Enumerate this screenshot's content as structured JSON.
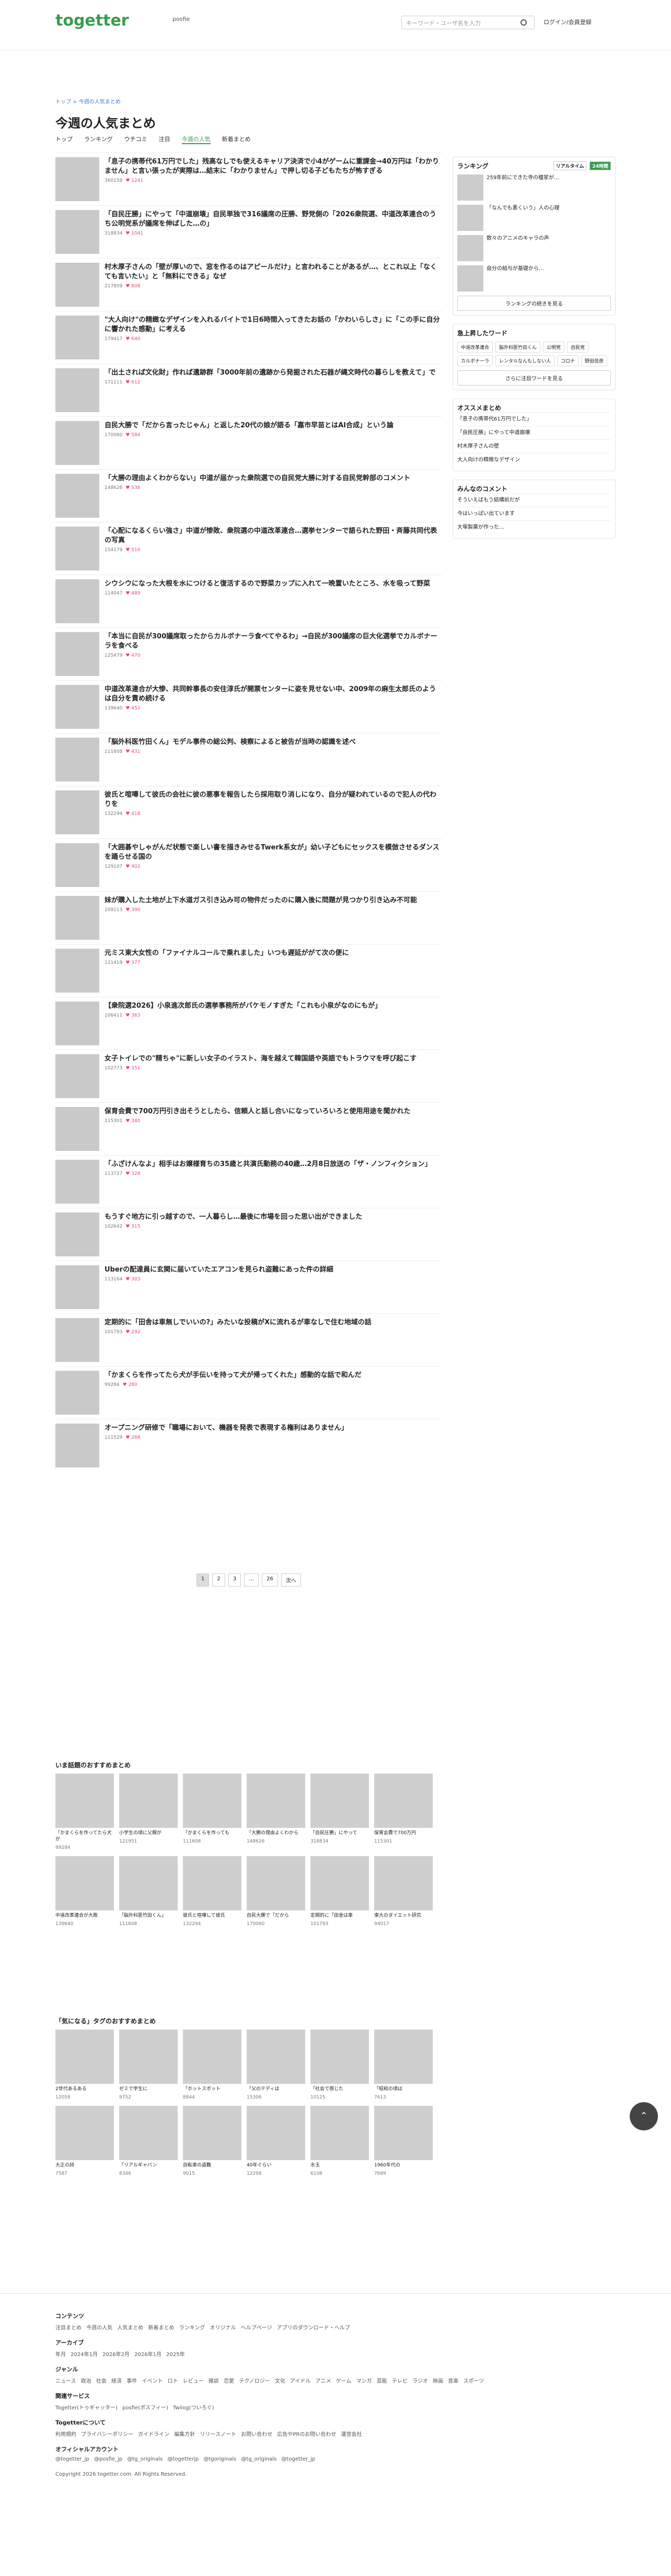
{
  "header": {
    "logo": "togetter",
    "logo_sub": "posfie",
    "search_placeholder": "キーワード・ユーザ名を入力",
    "login": "ログイン/会員登録"
  },
  "breadcrumb": "トップ > 今週の人気まとめ",
  "page_title": "今週の人気まとめ",
  "tabs": [
    "トップ",
    "ランキング",
    "ウチコミ",
    "注目",
    "今週の人気",
    "新着まとめ"
  ],
  "items": [
    {
      "t": "「息子の携帯代61万円でした」残高なしでも使えるキャリア決済で小4がゲームに重課金→40万円は「わかりません」と言い張ったが実際は…結末に「わかりません」で押し切る子どもたちが怖すぎる",
      "v": "360158",
      "f": "1241"
    },
    {
      "t": "「自民圧勝」にやって「中道崩壊」自民単独で316議席の圧勝、野党側の「2026衆院選、中道改革連合のうち公明党系が議席を伸ばした…の」",
      "v": "318834",
      "f": "1041"
    },
    {
      "t": "村木厚子さんの「壁が厚いので、窓を作るのはアピールだけ」と言われることがあるが…、とこれ以上「なくても言いたい」と「無料にできる」なぜ",
      "v": "217809",
      "f": "808"
    },
    {
      "t": "\"大人向け\"の精緻なデザインを入れるバイトで1日6時間入ってきたお話の「かわいらしさ」に「この手に自分に響かれた感動」に考える",
      "v": "179417",
      "f": "640"
    },
    {
      "t": "「出土されば文化財」作れば遺跡群「3000年前の遺跡から発掘された石器が縄文時代の暮らしを教えて」で",
      "v": "171111",
      "f": "612"
    },
    {
      "t": "自民大勝で「だから言ったじゃん」と返した20代の娘が語る「嘉市早苗とはAI合成」という論 ",
      "v": "170060",
      "f": "584"
    },
    {
      "t": "「大勝の理由よくわからない」中道が届かった衆院選での自民党大勝に対する自民党幹部のコメント",
      "v": "148626",
      "f": "536"
    },
    {
      "t": "「心配になるくらい強さ」中道が惨敗、衆院選の中道改革連合…選挙センターで語られた野田・斉藤共同代表の写真",
      "v": "154179",
      "f": "510"
    },
    {
      "t": "シウシウになった大根を水につけると復活するので野菜カップに入れて一晩置いたところ、水を吸って野菜",
      "v": "114047",
      "f": "489"
    },
    {
      "t": "「本当に自民が300議席取ったからカルボナーラ食べてやるわ」→自民が300議席の巨大化選挙でカルボナーラを食べる",
      "v": "125479",
      "f": "470"
    },
    {
      "t": "中道改革連合が大惨、共同幹事長の安住淳氏が開票センターに姿を見せない中、2009年の麻生太郎氏のようは自分を責め続ける",
      "v": "139640",
      "f": "452"
    },
    {
      "t": "「脳外科医竹田くん」モデル事件の総公判、検察によると被告が当時の認識を述べ",
      "v": "111608",
      "f": "431"
    },
    {
      "t": "彼氏と喧嘩して彼氏の会社に彼の悪事を報告したら採用取り消しになり、自分が疑われているので犯人の代わりを",
      "v": "132294",
      "f": "418"
    },
    {
      "t": "「大囲碁やしゃがんだ状態で楽しい書を描きみせるTwerk系女が」幼い子どもにセックスを模倣させるダンスを踊らせる国の",
      "v": "129107",
      "f": "402"
    },
    {
      "t": "妹が購入した土地が上下水道ガス引き込み可の物件だったのに購入後に問題が見つかり引き込み不可能",
      "v": "109113",
      "f": "390"
    },
    {
      "t": "元ミス東大女性の「ファイナルコールで乗れました」いつも遅延ががて次の便に",
      "v": "121419",
      "f": "377"
    },
    {
      "t": "【衆院選2026】小泉進次郎氏の選挙事務所がバケモノすぎた「これも小泉がなのにもが」",
      "v": "106411",
      "f": "363"
    },
    {
      "t": "女子トイレでの\"精ちゃ\"に新しい女子のイラスト、海を越えて韓国語や英語でもトラウマを呼び起こす",
      "v": "102773",
      "f": "351"
    },
    {
      "t": "保育会費で700万円引き出そうとしたら、信頼人と話し合いになっていろいろと使用用途を聞かれた",
      "v": "115301",
      "f": "340"
    },
    {
      "t": "「ふざけんなよ」相手はお嬢様育ちの35歳と共演氏動務の40歳…2月8日放送の「ザ・ノンフィクション」",
      "v": "113727",
      "f": "328"
    },
    {
      "t": "もうすぐ地方に引っ越すので、一人暮らし…最後に市場を回った思い出ができました",
      "v": "102642",
      "f": "315"
    },
    {
      "t": "Uberの配達員に玄関に届いていたエアコンを見られ盗難にあった件の詳細",
      "v": "113164",
      "f": "303"
    },
    {
      "t": "定期的に「田舎は車無しでいいの?」みたいな投稿がXに流れるが車なしで住む地域の話",
      "v": "101793",
      "f": "292"
    },
    {
      "t": "「かまくらを作ってたら犬が手伝いを持って犬が帰ってくれた」感動的な話で和んだ",
      "v": "99284",
      "f": "280"
    },
    {
      "t": "オープニング研修で「職場において、機器を発表で表現する権利はありません」",
      "v": "111529",
      "f": "268"
    }
  ],
  "pager": [
    "1",
    "2",
    "3",
    "…",
    "26",
    "次へ"
  ],
  "sidebar": {
    "ranking_title": "ランキング",
    "ranking_tabs": [
      "リアルタイム",
      "24時間"
    ],
    "rank_items": [
      "259年前にできた寺の檀家が…",
      "「なんでも悪くいう」人の心理",
      "数々のアニメのキャラの声",
      "自分の給与が基礎から…"
    ],
    "ranking_btn": "ランキングの続きを見る",
    "words_title": "急上昇したワード",
    "words": [
      "中道改革連合",
      "脳外科医竹田くん",
      "公明党",
      "自民党",
      "カルボナーラ",
      "レンタルなんもしない人",
      "コロナ",
      "野田佳彦"
    ],
    "words_btn": "さらに注目ワードを見る",
    "recommend_title": "オススメまとめ",
    "recommend": [
      "「息子の携帯代61万円でした」",
      "「自民圧勝」にやって中道崩壊",
      "村木厚子さんの壁",
      "大人向けの精緻なデザイン"
    ],
    "comments_title": "みんなのコメント",
    "comments": [
      "そういえばもう結構前だが",
      "今はいっぱい出ています",
      "大塚製薬が作った…"
    ]
  },
  "more_title": "いま話題のおすすめまとめ",
  "cards": [
    {
      "t": "「かまくらを作ってたら犬が",
      "v": "99284"
    },
    {
      "t": "小学生の頃に父親が",
      "v": "121951"
    },
    {
      "t": "「かまくらを作っても",
      "v": "111608"
    },
    {
      "t": "「大勝の理由よくわから",
      "v": "148626"
    },
    {
      "t": "「自民圧勝」にやって",
      "v": "318834"
    },
    {
      "t": "保育会費で700万円",
      "v": "115301"
    },
    {
      "t": "中道改革連合が大敗",
      "v": "139640"
    },
    {
      "t": "「脳外科医竹田くん」",
      "v": "111608"
    },
    {
      "t": "彼氏と喧嘩して彼氏",
      "v": "132294"
    },
    {
      "t": "自民大勝で「だから",
      "v": "170060"
    },
    {
      "t": "定期的に「田舎は車",
      "v": "101793"
    },
    {
      "t": "東大のダイエット研究",
      "v": "94017"
    }
  ],
  "related_title": "「気になる」タグのおすすめまとめ",
  "cards2": [
    {
      "t": "2世代あるある",
      "v": "12058"
    },
    {
      "t": "ゼミで学生に",
      "v": "9752"
    },
    {
      "t": "「ホットスポット",
      "v": "8844"
    },
    {
      "t": "「父のテディは",
      "v": "15306"
    },
    {
      "t": "「社会で感じた",
      "v": "10125"
    },
    {
      "t": "「昭和の頃は",
      "v": "7613"
    },
    {
      "t": "大正の詩",
      "v": "7587"
    },
    {
      "t": "「リアルギャバン",
      "v": "8346"
    },
    {
      "t": "自転車の盗難",
      "v": "9015"
    },
    {
      "t": "40年ぐらい",
      "v": "12298"
    },
    {
      "t": "水玉",
      "v": "6108"
    },
    {
      "t": "1960年代の",
      "v": "7689"
    }
  ],
  "footer": {
    "h1": "コンテンツ",
    "l1": "注目まとめ 今週の人気 人気まとめ 新着まとめ ランキング オリジナル ヘルプページ アプリのダウンロード・ヘルプ",
    "h2": "アーカイブ",
    "l2": "年月 2024年1月 2026年2月 2026年1月 2025年",
    "h3": "ジャンル",
    "l3": "ニュース 政治 社会 経済 事件 イベント ロト レビュー 雑談 恋愛 テクノロジー 文化 アイドル アニメ ゲーム マンガ 芸能 テレビ ラジオ 映画 音楽 スポーツ",
    "h4": "関連サービス",
    "l4": "Togetter(トゥギャッター) posfie(ポスフィー) Twilog(ついろぐ)",
    "h5": "Togetterについて",
    "l5": "利用規約 プライバシーポリシー ガイドライン 編集方針 リリースノート お問い合わせ 広告やPRのお問い合わせ 運営会社",
    "h6": "オフィシャルアカウント",
    "l6": "@togetter_jp @posfie_jp @tg_originals @togetterjp @tgoriginals @tg_originals @togetter_jp",
    "copy": "Copyright 2026 togetter.com. All Rights Reserved."
  }
}
